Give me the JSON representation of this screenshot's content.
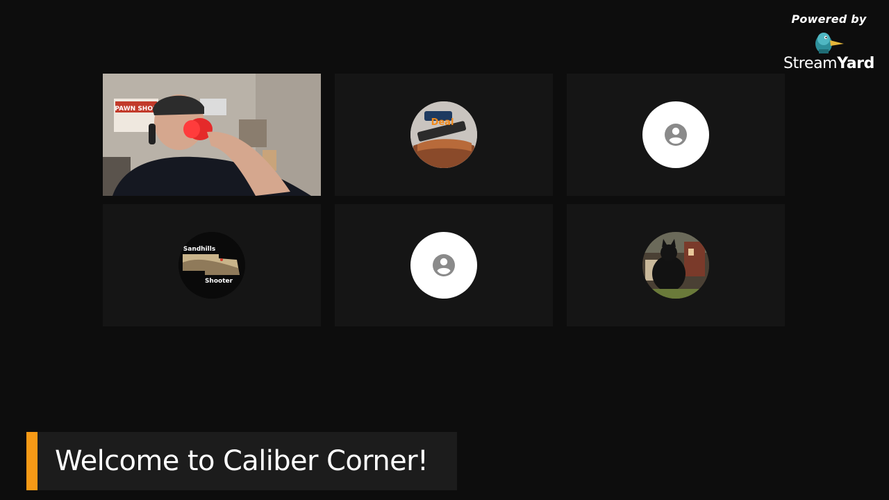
{
  "branding": {
    "powered_by": "Powered by",
    "name_part1": "Stream",
    "name_part2": "Yard",
    "logo_icon": "duck-logo-icon"
  },
  "participants": [
    {
      "type": "video",
      "icon": "webcam-video",
      "poster_text": "PAWN SHOP"
    },
    {
      "type": "avatar-image",
      "icon": "channel-logo-avatar"
    },
    {
      "type": "default-avatar",
      "icon": "person-icon"
    },
    {
      "type": "avatar-image",
      "icon": "nebraska-map-avatar",
      "line1": "Sandhills",
      "line2": "Shooter"
    },
    {
      "type": "default-avatar",
      "icon": "person-icon"
    },
    {
      "type": "avatar-image",
      "icon": "cat-photo-avatar"
    }
  ],
  "banner": {
    "text": "Welcome to Caliber Corner!",
    "accent_color": "#f79a16"
  }
}
